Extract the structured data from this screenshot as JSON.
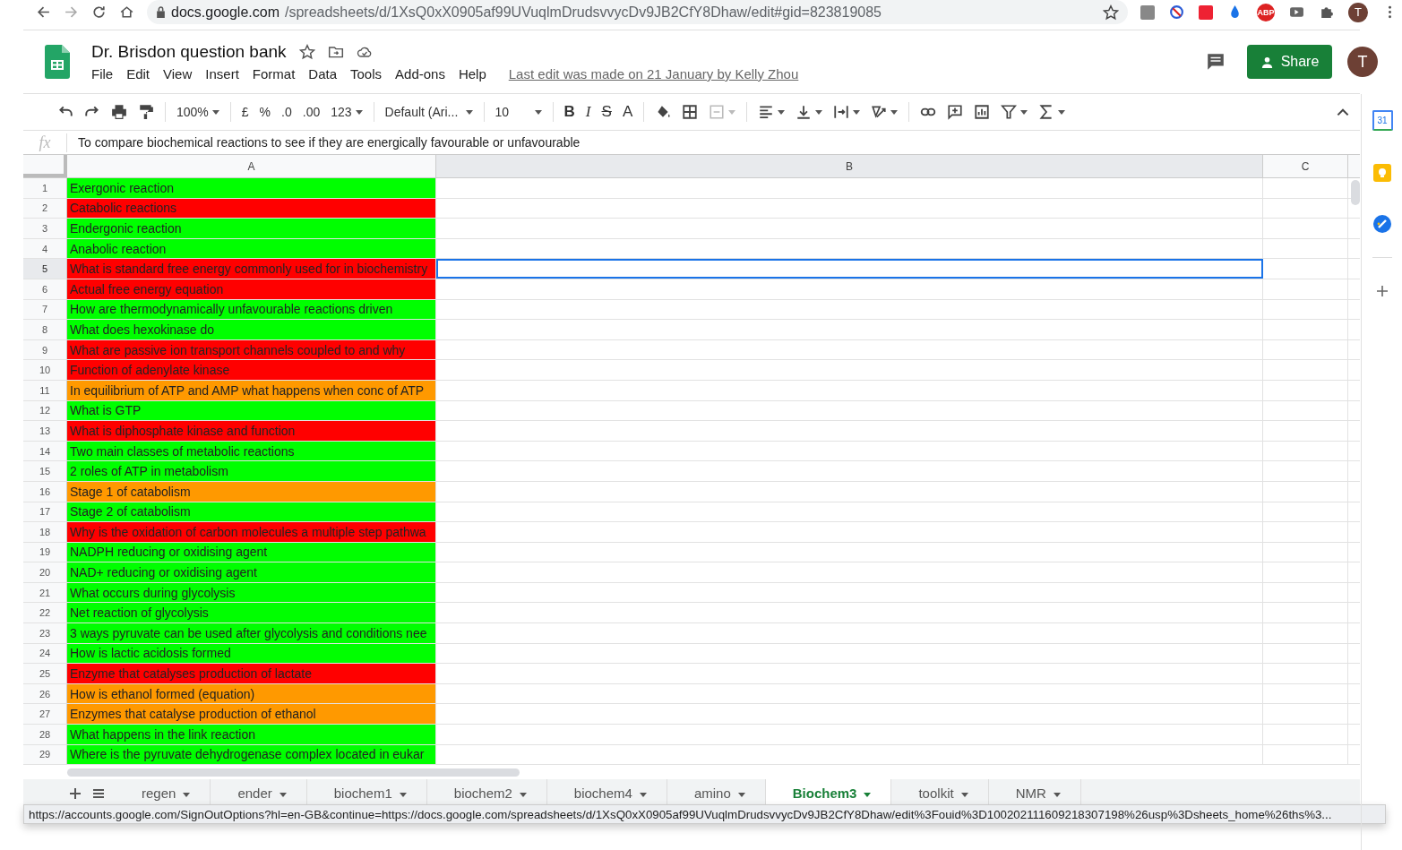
{
  "browser": {
    "url_host": "docs.google.com",
    "url_path": "/spreadsheets/d/1XsQ0xX0905af99UVuqlmDrudsvvycDv9JB2CfY8Dhaw/edit#gid=823819085",
    "extension_badge": "ABP",
    "profile": "T"
  },
  "doc": {
    "title": "Dr. Brisdon question bank",
    "menu": [
      "File",
      "Edit",
      "View",
      "Insert",
      "Format",
      "Data",
      "Tools",
      "Add-ons",
      "Help"
    ],
    "last_edit": "Last edit was made on 21 January by Kelly Zhou",
    "share": "Share",
    "avatar": "T"
  },
  "toolbar": {
    "zoom": "100%",
    "currency": "£",
    "percent": "%",
    "dec_less": ".0",
    "dec_more": ".00",
    "number_format": "123",
    "font": "Default (Ari...",
    "size": "10",
    "bold": "B",
    "italic": "I",
    "strike": "S",
    "text_color": "A"
  },
  "formula_bar": {
    "fx": "fx",
    "value": "To compare biochemical reactions to see if they are energically favourable or unfavourable"
  },
  "columns": [
    "A",
    "B",
    "C"
  ],
  "rows": [
    {
      "num": "1",
      "a": "Exergonic reaction",
      "color": "#00ff00",
      "selected": false
    },
    {
      "num": "2",
      "a": "Catabolic reactions",
      "color": "#ff0000",
      "selected": false
    },
    {
      "num": "3",
      "a": "Endergonic reaction",
      "color": "#00ff00",
      "selected": false
    },
    {
      "num": "4",
      "a": "Anabolic reaction",
      "color": "#00ff00",
      "selected": false
    },
    {
      "num": "5",
      "a": "What is standard free energy commonly used for in biochemistry",
      "color": "#ff0000",
      "selected": true
    },
    {
      "num": "6",
      "a": "Actual free energy equation",
      "color": "#ff0000",
      "selected": false
    },
    {
      "num": "7",
      "a": "How are thermodynamically unfavourable reactions driven",
      "color": "#00ff00",
      "selected": false
    },
    {
      "num": "8",
      "a": "What does hexokinase do",
      "color": "#00ff00",
      "selected": false
    },
    {
      "num": "9",
      "a": "What are passive ion transport channels coupled to and why",
      "color": "#ff0000",
      "selected": false
    },
    {
      "num": "10",
      "a": "Function of adenylate kinase",
      "color": "#ff0000",
      "selected": false
    },
    {
      "num": "11",
      "a": "In equilibrium of ATP and AMP what happens when conc of ATP",
      "color": "#ff9900",
      "selected": false
    },
    {
      "num": "12",
      "a": "What is GTP",
      "color": "#00ff00",
      "selected": false
    },
    {
      "num": "13",
      "a": "What is diphosphate kinase and function",
      "color": "#ff0000",
      "selected": false
    },
    {
      "num": "14",
      "a": "Two main classes of metabolic reactions",
      "color": "#00ff00",
      "selected": false
    },
    {
      "num": "15",
      "a": "2 roles of ATP in metabolism",
      "color": "#00ff00",
      "selected": false
    },
    {
      "num": "16",
      "a": "Stage 1 of catabolism",
      "color": "#ff9900",
      "selected": false
    },
    {
      "num": "17",
      "a": "Stage 2 of catabolism",
      "color": "#00ff00",
      "selected": false
    },
    {
      "num": "18",
      "a": "Why is the oxidation of carbon molecules a multiple step pathwa",
      "color": "#ff0000",
      "selected": false
    },
    {
      "num": "19",
      "a": "NADPH reducing or oxidising agent",
      "color": "#00ff00",
      "selected": false
    },
    {
      "num": "20",
      "a": "NAD+ reducing or oxidising agent",
      "color": "#00ff00",
      "selected": false
    },
    {
      "num": "21",
      "a": "What occurs during glycolysis",
      "color": "#00ff00",
      "selected": false
    },
    {
      "num": "22",
      "a": "Net reaction of glycolysis",
      "color": "#00ff00",
      "selected": false
    },
    {
      "num": "23",
      "a": "3 ways pyruvate can be used after glycolysis and conditions nee",
      "color": "#00ff00",
      "selected": false
    },
    {
      "num": "24",
      "a": "How is lactic acidosis formed",
      "color": "#00ff00",
      "selected": false
    },
    {
      "num": "25",
      "a": "Enzyme that catalyses production of lactate",
      "color": "#ff0000",
      "selected": false
    },
    {
      "num": "26",
      "a": "How is ethanol formed (equation)",
      "color": "#ff9900",
      "selected": false
    },
    {
      "num": "27",
      "a": "Enzymes that catalyse production of ethanol",
      "color": "#ff9900",
      "selected": false
    },
    {
      "num": "28",
      "a": "What happens in the link reaction",
      "color": "#00ff00",
      "selected": false
    },
    {
      "num": "29",
      "a": "Where is the pyruvate dehydrogenase complex located in eukar",
      "color": "#00ff00",
      "selected": false
    }
  ],
  "sheet_tabs": [
    {
      "label": "regen",
      "selected": false
    },
    {
      "label": "ender",
      "selected": false
    },
    {
      "label": "biochem1",
      "selected": false
    },
    {
      "label": "biochem2",
      "selected": false
    },
    {
      "label": "biochem4",
      "selected": false
    },
    {
      "label": "amino",
      "selected": false
    },
    {
      "label": "Biochem3",
      "selected": true
    },
    {
      "label": "toolkit",
      "selected": false
    },
    {
      "label": "NMR",
      "selected": false
    }
  ],
  "side_panel": {
    "calendar_day": "31"
  },
  "status_tooltip": "https://accounts.google.com/SignOutOptions?hl=en-GB&continue=https://docs.google.com/spreadsheets/d/1XsQ0xX0905af99UVuqlmDrudsvvycDv9JB2CfY8Dhaw/edit%3Fouid%3D100202111609218307198%26usp%3Dsheets_home%26ths%3..."
}
